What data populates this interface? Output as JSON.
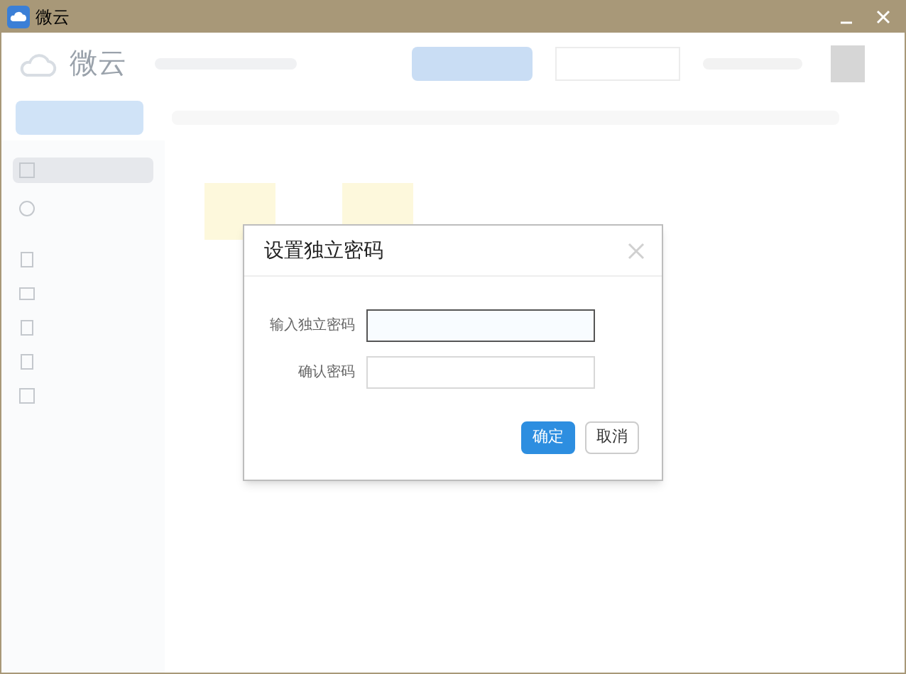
{
  "window": {
    "title": "微云"
  },
  "header": {
    "app_name": "微云"
  },
  "dialog": {
    "title": "设置独立密码",
    "fields": [
      {
        "label": "输入独立密码",
        "focused": true
      },
      {
        "label": "确认密码",
        "focused": false
      }
    ],
    "buttons": [
      {
        "label": "确定",
        "kind": "primary"
      },
      {
        "label": "取消",
        "kind": "secondary"
      }
    ]
  }
}
